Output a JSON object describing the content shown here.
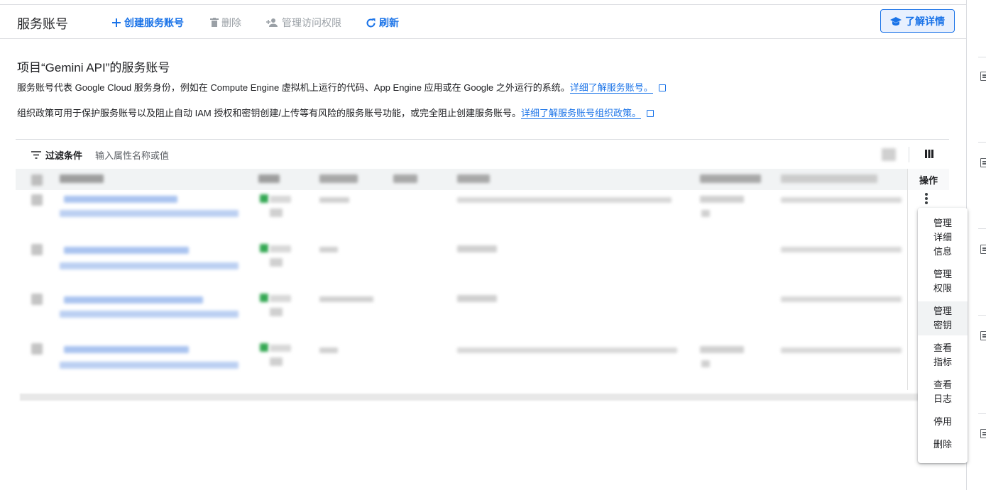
{
  "toolbar": {
    "title": "服务账号",
    "create": "创建服务账号",
    "delete": "删除",
    "manage_access": "管理访问权限",
    "refresh": "刷新",
    "learn_more": "了解详情"
  },
  "content": {
    "heading": "项目“Gemini API”的服务账号",
    "desc1": "服务账号代表 Google Cloud 服务身份，例如在 Compute Engine 虚拟机上运行的代码、App Engine 应用或在 Google 之外运行的系统。",
    "desc1_link": "详细了解服务账号。",
    "desc2": "组织政策可用于保护服务账号以及阻止自动 IAM 授权和密钥创建/上传等有风险的服务账号功能，或完全阻止创建服务账号。",
    "desc2_link": "详细了解服务账号组织政策。"
  },
  "filter": {
    "label": "过滤条件",
    "placeholder": "输入属性名称或值"
  },
  "table": {
    "actions_header": "操作",
    "row_count": 4
  },
  "menu": {
    "items": [
      [
        "管理",
        "详细",
        "信息"
      ],
      [
        "管理",
        "权限"
      ],
      [
        "管理",
        "密钥"
      ],
      [
        "查看",
        "指标"
      ],
      [
        "查看",
        "日志"
      ],
      [
        "停用"
      ],
      [
        "删除"
      ]
    ]
  },
  "colors": {
    "accent": "#1a73e8",
    "border": "#dadce0",
    "status_green": "#34a853"
  }
}
